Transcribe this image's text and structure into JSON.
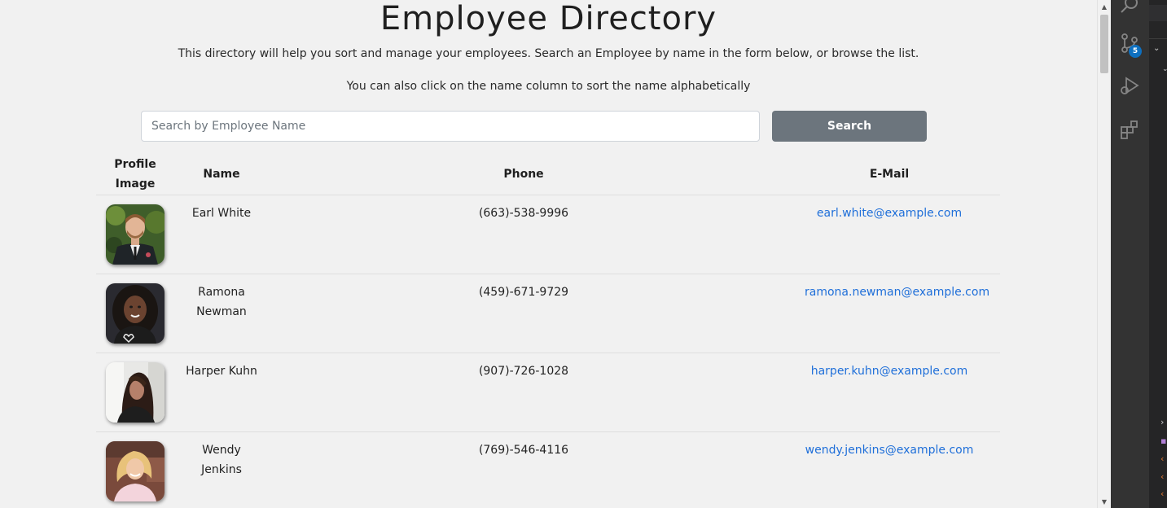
{
  "page": {
    "title": "Employee Directory",
    "intro_line_1": "This directory will help you sort and manage your employees. Search an Employee by name in the form below, or browse the list.",
    "intro_line_2": "You can also click on the name column to sort the name alphabetically"
  },
  "search": {
    "placeholder": "Search by Employee Name",
    "value": "",
    "button_label": "Search"
  },
  "table": {
    "headers": {
      "image": "Profile Image",
      "name": "Name",
      "phone": "Phone",
      "email": "E-Mail"
    },
    "rows": [
      {
        "name": "Earl White",
        "phone": "(663)-538-9996",
        "email": "earl.white@example.com"
      },
      {
        "name": "Ramona Newman",
        "phone": "(459)-671-9729",
        "email": "ramona.newman@example.com"
      },
      {
        "name": "Harper Kuhn",
        "phone": "(907)-726-1028",
        "email": "harper.kuhn@example.com"
      },
      {
        "name": "Wendy Jenkins",
        "phone": "(769)-546-4116",
        "email": "wendy.jenkins@example.com"
      }
    ]
  },
  "editor": {
    "activity_icons": [
      "search-icon",
      "source-control-icon",
      "run-debug-icon",
      "extensions-icon"
    ],
    "source_control_badge": "5"
  },
  "colors": {
    "page_background": "#f1f1f1",
    "link": "#1f6fd9",
    "search_button": "#6c757d",
    "activity_bar": "#333333",
    "badge": "#0e70c0"
  }
}
